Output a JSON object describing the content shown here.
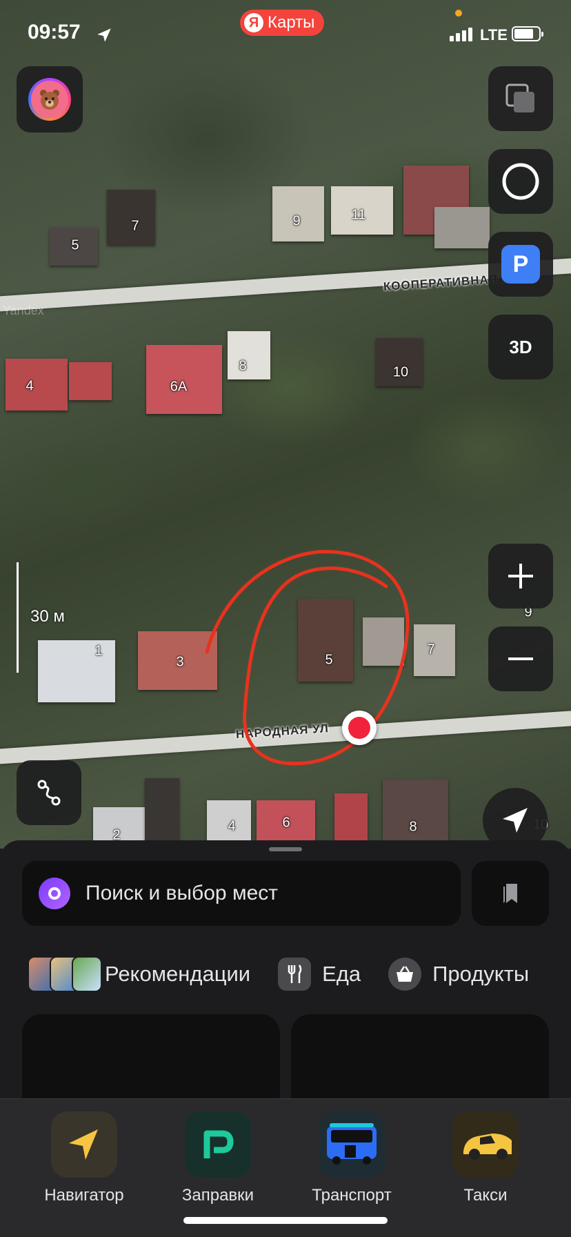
{
  "status_bar": {
    "time": "09:57",
    "network": "LTE"
  },
  "app_badge": {
    "logo_letter": "Я",
    "title": "Карты"
  },
  "map": {
    "watermark": "Yandex",
    "streets": [
      "КООПЕРАТИВНАЯ УЛ",
      "НАРОДНАЯ УЛ"
    ],
    "house_numbers": [
      "5",
      "7",
      "9",
      "11",
      "4",
      "6А",
      "8",
      "10",
      "1",
      "3",
      "5",
      "7",
      "9",
      "2",
      "4",
      "6",
      "8",
      "10"
    ],
    "scale_label": "30 м",
    "layers_icon": "layers-icon",
    "controls": {
      "three_d": "3D",
      "parking": "P",
      "zoom_in": "+",
      "zoom_out": "−"
    },
    "annotation_color": "#e8321e"
  },
  "search": {
    "placeholder": "Поиск и выбор мест"
  },
  "categories": [
    {
      "label": "Рекомендации",
      "icon": "recommendations-images"
    },
    {
      "label": "Еда",
      "icon": "fork-knife-icon"
    },
    {
      "label": "Продукты",
      "icon": "basket-icon"
    }
  ],
  "dock": [
    {
      "label": "Навигатор",
      "icon": "navigator-arrow-icon",
      "color": "#f5c542"
    },
    {
      "label": "Заправки",
      "icon": "fuel-p-icon",
      "color": "#1ec99b"
    },
    {
      "label": "Транспорт",
      "icon": "bus-icon",
      "color": "#2d6cf5"
    },
    {
      "label": "Такси",
      "icon": "taxi-car-icon",
      "color": "#f5c542"
    }
  ]
}
